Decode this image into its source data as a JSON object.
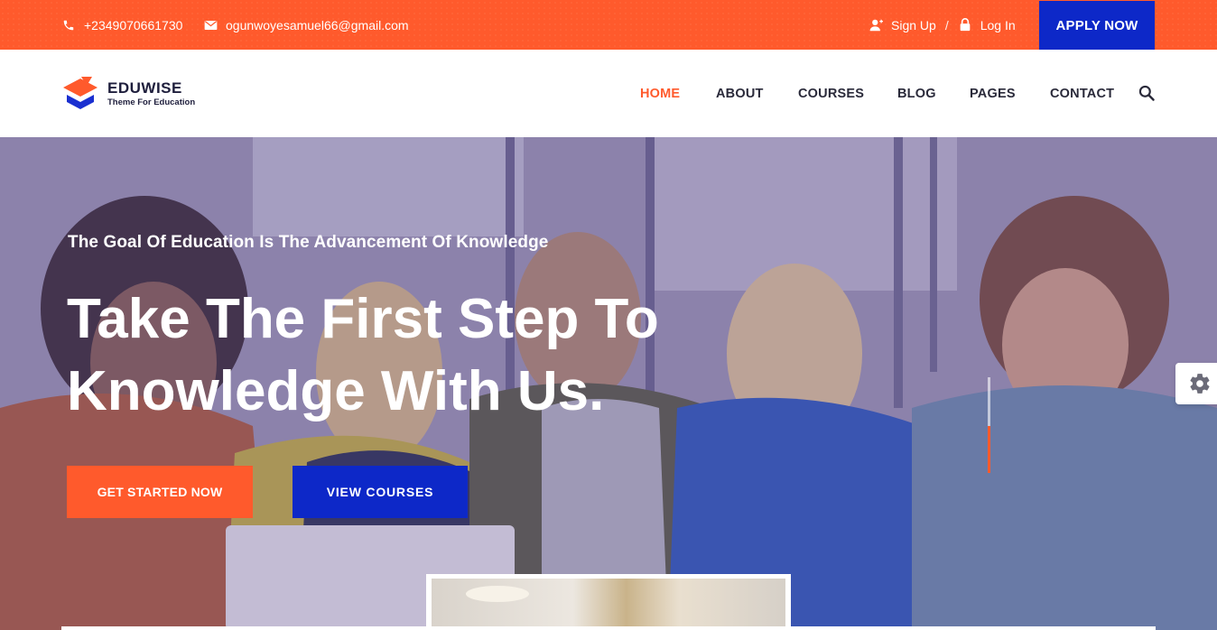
{
  "topbar": {
    "phone": "+2349070661730",
    "email": "ogunwoyesamuel66@gmail.com",
    "sign_up": "Sign Up",
    "separator": "/",
    "log_in": "Log In",
    "apply_now": "APPLY NOW",
    "icons": [
      "phone-icon",
      "mail-icon",
      "user-icon",
      "lock-icon"
    ]
  },
  "brand": {
    "name": "EDUWISE",
    "tagline": "Theme For Education"
  },
  "nav": {
    "items": [
      {
        "label": "HOME",
        "active": true
      },
      {
        "label": "ABOUT"
      },
      {
        "label": "COURSES"
      },
      {
        "label": "BLOG"
      },
      {
        "label": "PAGES"
      },
      {
        "label": "CONTACT"
      }
    ],
    "search_icon": "search-icon"
  },
  "hero": {
    "tagline": "The Goal Of Education Is The Advancement Of Knowledge",
    "headline_line1": "Take The First Step To",
    "headline_line2": "Knowledge With Us.",
    "primary_button": "GET STARTED NOW",
    "secondary_button": "VIEW COURSES"
  },
  "colors": {
    "accent": "#ff5a2c",
    "brand_blue": "#0d28c8",
    "nav_text": "#2a2a3a"
  }
}
